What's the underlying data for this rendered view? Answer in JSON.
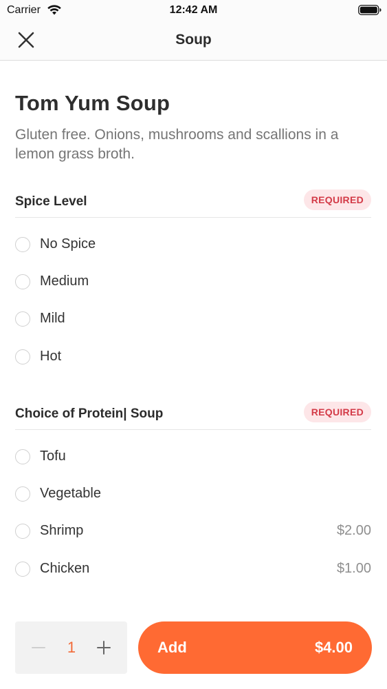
{
  "status_bar": {
    "carrier": "Carrier",
    "time": "12:42 AM",
    "wifi_icon": "wifi-icon",
    "battery_icon": "battery-icon"
  },
  "nav": {
    "title": "Soup",
    "close_icon": "close-icon"
  },
  "item": {
    "title": "Tom Yum Soup",
    "description": "Gluten free. Onions, mushrooms and scallions in a lemon grass broth."
  },
  "sections": [
    {
      "title": "Spice Level",
      "badge": "REQUIRED",
      "options": [
        {
          "label": "No Spice",
          "price": ""
        },
        {
          "label": "Medium",
          "price": ""
        },
        {
          "label": "Mild",
          "price": ""
        },
        {
          "label": "Hot",
          "price": ""
        }
      ]
    },
    {
      "title": "Choice of Protein| Soup",
      "badge": "REQUIRED",
      "options": [
        {
          "label": "Tofu",
          "price": ""
        },
        {
          "label": "Vegetable",
          "price": ""
        },
        {
          "label": "Shrimp",
          "price": "$2.00"
        },
        {
          "label": "Chicken",
          "price": "$1.00"
        }
      ]
    }
  ],
  "footer": {
    "quantity": "1",
    "add_label": "Add",
    "add_price": "$4.00"
  },
  "colors": {
    "accent": "#ff6a33",
    "required_bg": "#fde6e8",
    "required_text": "#d33a47"
  }
}
